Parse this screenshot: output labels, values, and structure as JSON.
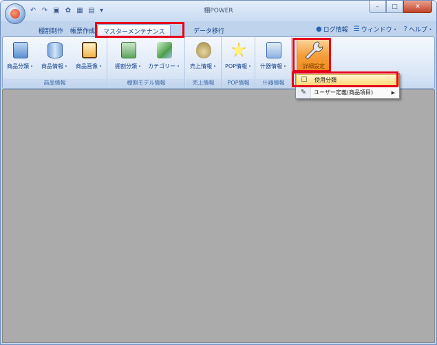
{
  "window": {
    "title": "棚POWER"
  },
  "quick_access": [
    {
      "icon": "undo-icon",
      "glyph": "↶"
    },
    {
      "icon": "redo-icon",
      "glyph": "↷"
    },
    {
      "icon": "save-icon",
      "glyph": "▣"
    },
    {
      "icon": "refresh-icon",
      "glyph": "✿"
    },
    {
      "icon": "grid-icon",
      "glyph": "▦"
    },
    {
      "icon": "export-icon",
      "glyph": "▤"
    }
  ],
  "window_controls": {
    "minimize": "–",
    "maximize": "□",
    "close": "✕"
  },
  "tabs": [
    {
      "label": "棚割制作",
      "active": false
    },
    {
      "label": "帳票作成",
      "active": false
    },
    {
      "label": "マスターメンテナンス",
      "active": true
    },
    {
      "label": "データ移行",
      "active": false
    }
  ],
  "right_menu": {
    "login_info": "ログ情報",
    "window": "ウィンドウ・",
    "help": "ヘルプ・"
  },
  "ribbon": {
    "groups": [
      {
        "label": "商品情報",
        "buttons": [
          "商品分類・",
          "商品情報・",
          "商品画像・"
        ]
      },
      {
        "label": "棚割モデル情報",
        "buttons": [
          "棚割分類・",
          "カテゴリー・"
        ]
      },
      {
        "label": "売上情報",
        "buttons": [
          "売上情報・"
        ]
      },
      {
        "label": "POP情報",
        "buttons": [
          "POP情報・"
        ]
      },
      {
        "label": "什器情報",
        "buttons": [
          "什器情報・"
        ]
      }
    ],
    "detail_button": "詳細設定"
  },
  "dropdown": {
    "items": [
      {
        "label": "使用分類",
        "selected": true,
        "has_submenu": false
      },
      {
        "label": "ユーザー定義(商品項目)",
        "selected": false,
        "has_submenu": true
      }
    ]
  },
  "colors": {
    "highlight": "#e4001a",
    "workspace": "#ababab",
    "ribbon": "#dbe7f6"
  }
}
